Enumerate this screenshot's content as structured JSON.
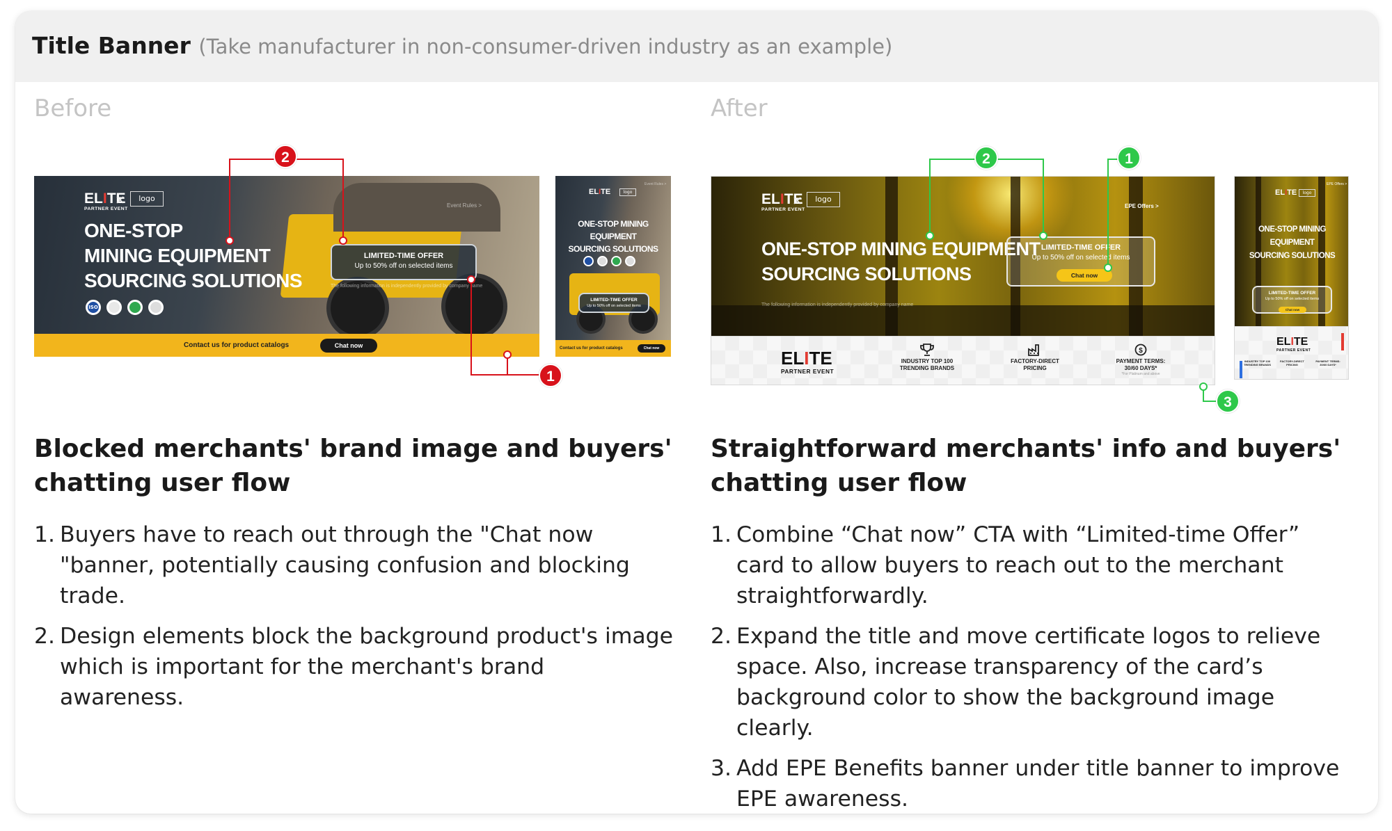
{
  "header": {
    "title": "Title Banner",
    "subtitle": "(Take manufacturer in non-consumer-driven industry as an example)"
  },
  "before": {
    "label": "Before",
    "banner": {
      "logo": {
        "main_pre": "EL",
        "main_i": "I",
        "main_post": "TE",
        "sub": "PARTNER EVENT"
      },
      "logo_box": "logo",
      "cross": "×",
      "headline_lines": [
        "ONE-STOP",
        "MINING EQUIPMENT",
        "SOURCING SOLUTIONS"
      ],
      "cert_badge": "ISO",
      "event_rules": "Event Rules >",
      "offer": {
        "title": "LIMITED-TIME OFFER",
        "subtitle": "Up to 50% off on selected items"
      },
      "fine_print": "The following information is independently provided by company name",
      "bar_text": "Contact us for product catalogs",
      "chat": "Chat now"
    },
    "mobile": {
      "headline_lines": [
        "ONE-STOP MINING EQUIPMENT",
        "SOURCING SOLUTIONS"
      ],
      "offer": {
        "title": "LIMITED-TIME OFFER",
        "subtitle": "Up to 50% off on selected items"
      },
      "bar_text": "Contact us for product catalogs",
      "chat": "Chat now",
      "event_rules": "Event Rules >"
    },
    "heading": "Blocked merchants' brand image and buyers' chatting user flow",
    "points": [
      "Buyers have to reach out through the \"Chat now \"banner, potentially causing confusion and blocking trade.",
      "Design elements block the background product's image which is important for the merchant's brand awareness."
    ],
    "badges": [
      "2",
      "1"
    ]
  },
  "after": {
    "label": "After",
    "banner": {
      "logo": {
        "main_pre": "EL",
        "main_i": "I",
        "main_post": "TE",
        "sub": "PARTNER EVENT"
      },
      "logo_box": "logo",
      "cross": "×",
      "epe_offers": "EPE Offers >",
      "headline_lines": [
        "ONE-STOP MINING EQUIPMENT",
        "SOURCING SOLUTIONS"
      ],
      "offer": {
        "title": "LIMITED-TIME OFFER",
        "subtitle": "Up to 50% off on selected items"
      },
      "chat": "Chat now",
      "fine_print": "The following information is independently provided by company name",
      "benefits": [
        {
          "icon": "trophy-icon",
          "label": "INDUSTRY TOP 100\nTRENDING BRANDS"
        },
        {
          "icon": "factory-icon",
          "label": "FACTORY-DIRECT\nPRICING"
        },
        {
          "icon": "dollar-clock-icon",
          "label": "PAYMENT TERMS:\n30/60 DAYS*",
          "note": "*For Platinum and above"
        }
      ]
    },
    "mobile": {
      "headline_lines": [
        "ONE-STOP MINING EQUIPMENT",
        "SOURCING SOLUTIONS"
      ],
      "epe_offers": "EPE Offers >",
      "offer": {
        "title": "LIMITED-TIME OFFER",
        "subtitle": "Up to 50% off on selected items"
      },
      "chat": "Chat now",
      "benefits": [
        "INDUSTRY TOP 100\nTRENDING BRANDS",
        "FACTORY-DIRECT\nPRICING",
        "PAYMENT TERMS:\n30/60 DAYS*"
      ]
    },
    "heading": "Straightforward merchants' info and buyers' chatting user flow",
    "points": [
      "Combine “Chat now” CTA with “Limited-time Offer” card to allow buyers to reach out to the merchant straightforwardly.",
      "Expand the title and move certificate logos to relieve space. Also, increase transparency of the card’s background color to show the background image clearly.",
      "Add EPE Benefits banner under title banner to improve EPE awareness."
    ],
    "badges": [
      "2",
      "1",
      "3"
    ]
  },
  "colors": {
    "accent_red": "#d8121b",
    "accent_green": "#2ec84a",
    "cta_yellow": "#f2b51c"
  }
}
